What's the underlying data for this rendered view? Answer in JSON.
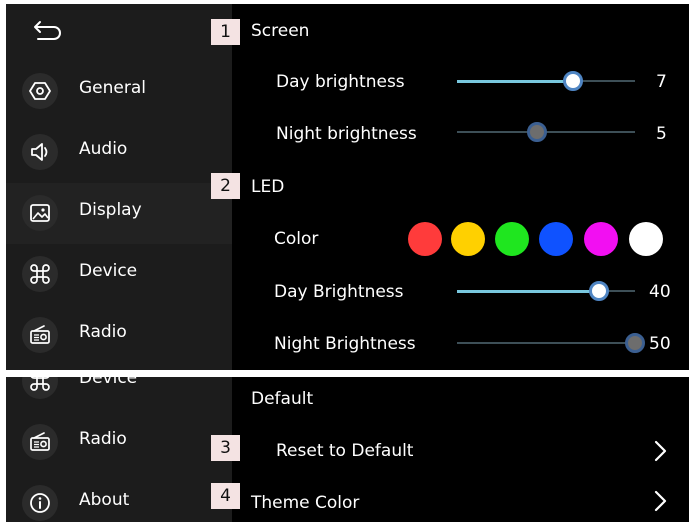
{
  "sidebar": {
    "items": [
      {
        "label": "General",
        "icon": "hexagon-icon"
      },
      {
        "label": "Audio",
        "icon": "speaker-icon"
      },
      {
        "label": "Display",
        "icon": "image-icon"
      },
      {
        "label": "Device",
        "icon": "command-icon"
      },
      {
        "label": "Radio",
        "icon": "radio-icon"
      }
    ],
    "active": "Display"
  },
  "sidebar2": {
    "items": [
      {
        "label": "Device",
        "icon": "command-icon"
      },
      {
        "label": "Radio",
        "icon": "radio-icon"
      },
      {
        "label": "About",
        "icon": "info-icon"
      }
    ]
  },
  "screen": {
    "badge": "1",
    "title": "Screen",
    "day_label": "Day brightness",
    "day_value": "7",
    "day_fraction": 0.65,
    "night_label": "Night brightness",
    "night_value": "5",
    "night_fraction": 0.45
  },
  "led": {
    "badge": "2",
    "title": "LED",
    "color_label": "Color",
    "colors": [
      "#ff3b3b",
      "#ffd000",
      "#1fe61f",
      "#0f52ff",
      "#f20ff2",
      "#ffffff"
    ],
    "day_label": "Day Brightness",
    "day_value": "40",
    "day_fraction": 0.8,
    "night_label": "Night Brightness",
    "night_value": "50",
    "night_fraction": 1.0
  },
  "defaults": {
    "title": "Default",
    "reset_badge": "3",
    "reset_label": "Reset to Default",
    "theme_badge": "4",
    "theme_label": "Theme Color"
  }
}
